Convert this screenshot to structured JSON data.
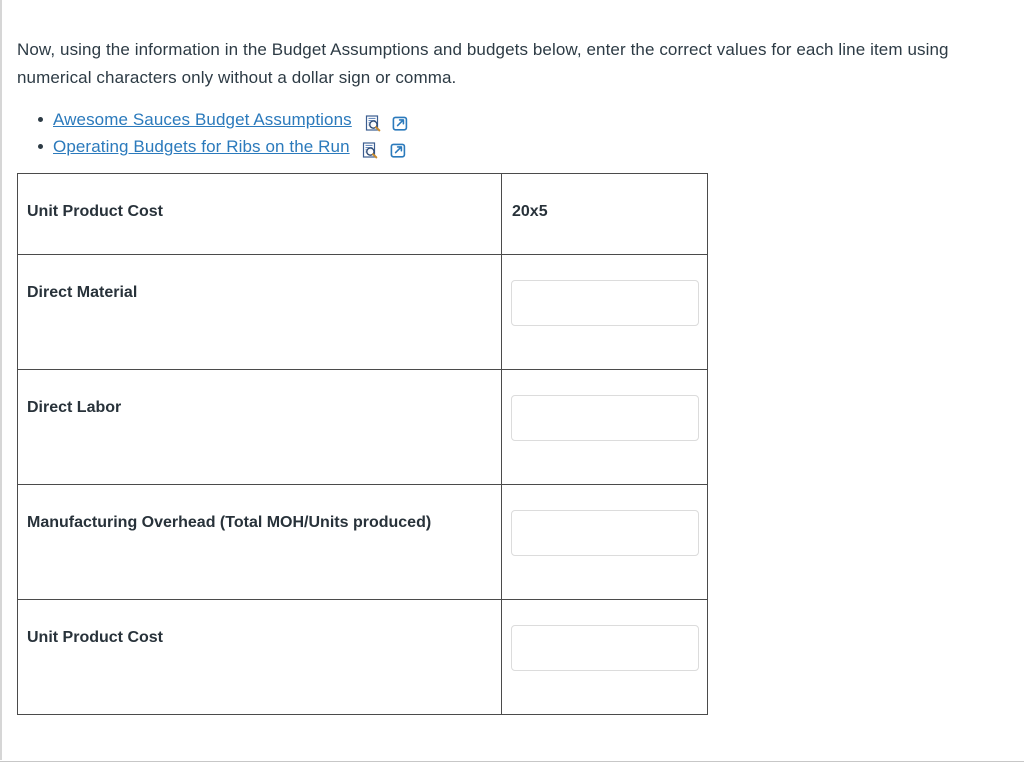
{
  "question": {
    "instructions": "Now, using the information in the Budget Assumptions and budgets below, enter the correct values for each line item using numerical characters only without a dollar sign or comma."
  },
  "resources": {
    "links": [
      {
        "label": "Awesome Sauces Budget Assumptions",
        "preview_icon": "document-preview-icon",
        "external_icon": "open-in-new-window-icon"
      },
      {
        "label": "Operating Budgets for Ribs on the Run",
        "preview_icon": "document-preview-icon",
        "external_icon": "open-in-new-window-icon"
      }
    ],
    "link_color": "#2b7abc"
  },
  "table": {
    "header": {
      "label": "Unit Product Cost",
      "value": "20x5"
    },
    "rows": [
      {
        "label": "Direct Material",
        "value": "",
        "placeholder": ""
      },
      {
        "label": "Direct Labor",
        "value": "",
        "placeholder": ""
      },
      {
        "label": "Manufacturing Overhead (Total MOH/Units produced)",
        "value": "",
        "placeholder": ""
      },
      {
        "label": "Unit Product Cost",
        "value": "",
        "placeholder": ""
      }
    ],
    "border_color": "#4b4b4b",
    "input_border_color": "#dcdcdc"
  },
  "theme": {
    "text_color": "#2d3b45",
    "background": "#ffffff"
  }
}
